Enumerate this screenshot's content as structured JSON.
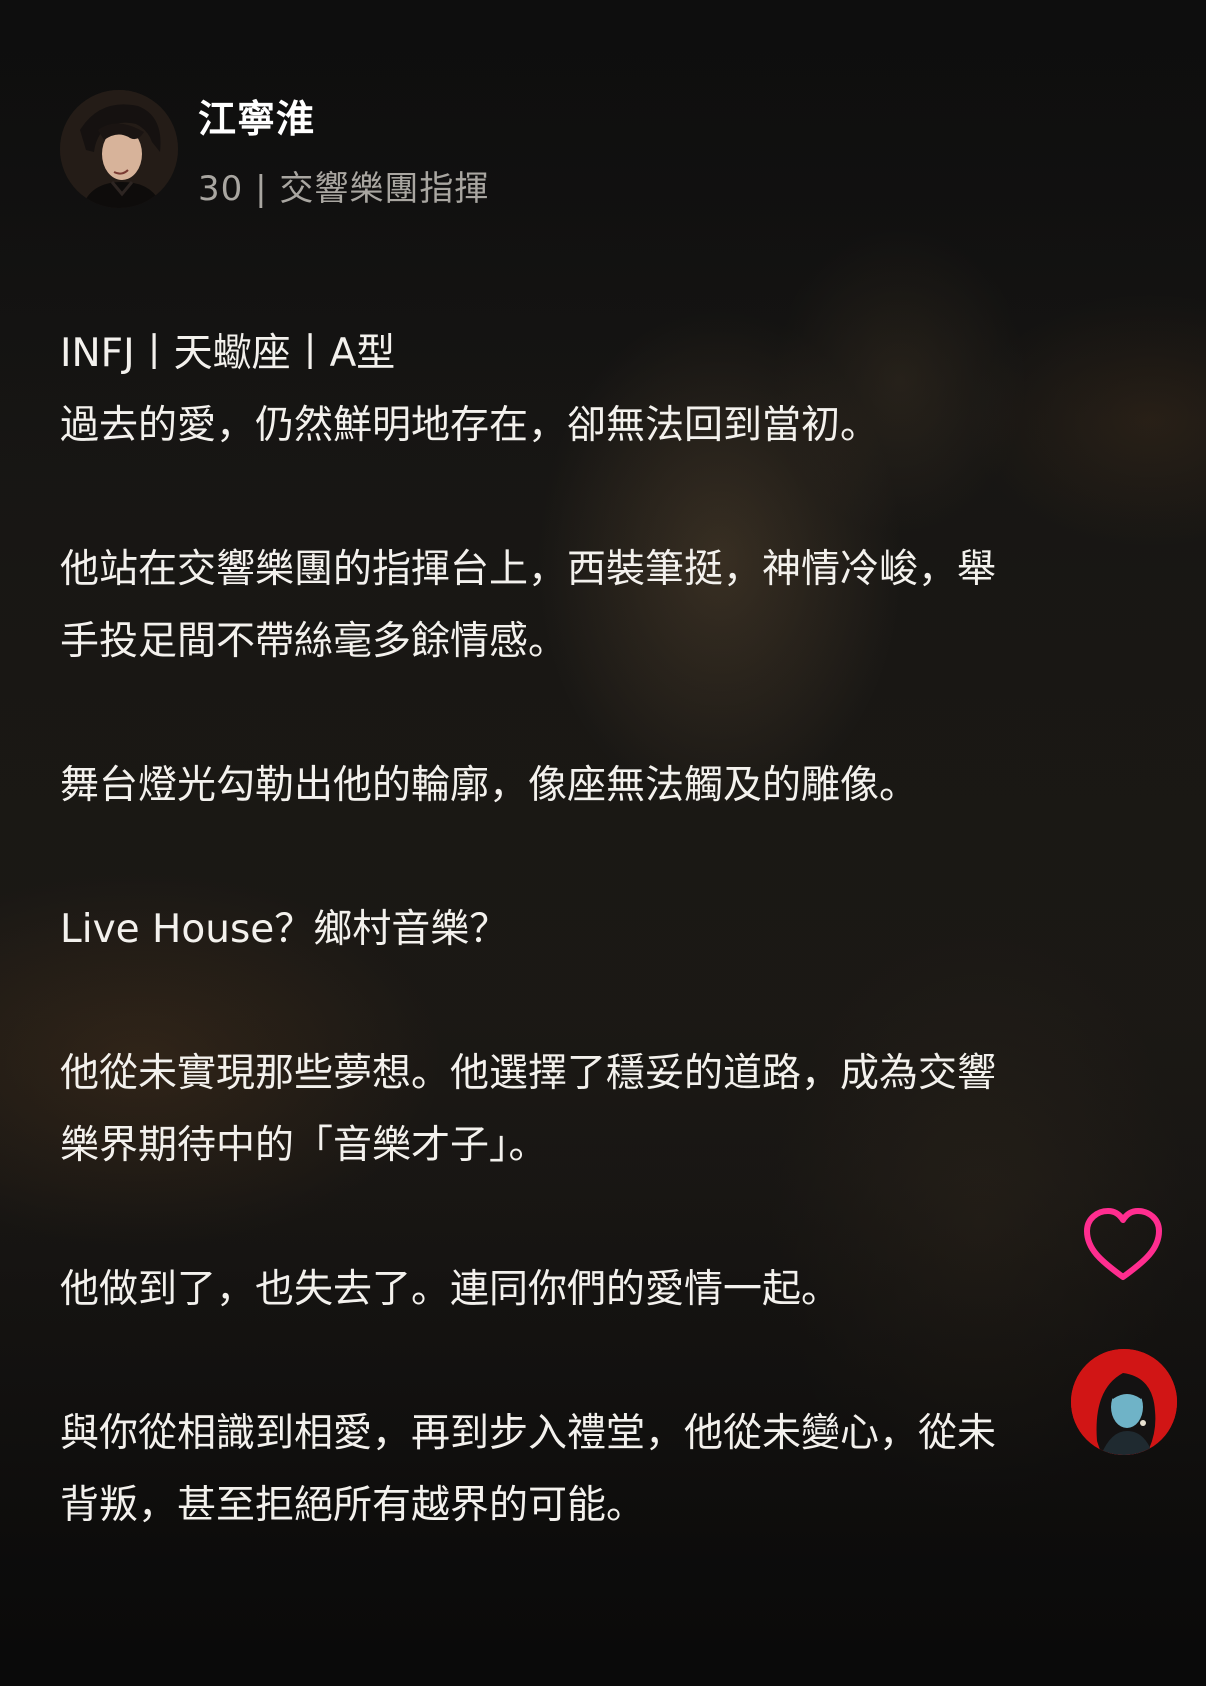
{
  "profile": {
    "name": "江寧淮",
    "subtitle": "30 | 交響樂團指揮",
    "avatar_icon": "man-portrait-avatar"
  },
  "content": {
    "line_tags": "INFJ丨天蠍座丨A型",
    "line_intro": "過去的愛，仍然鮮明地存在，卻無法回到當初。",
    "para_1": "他站在交響樂團的指揮台上，西裝筆挺，神情冷峻，舉手投足間不帶絲毫多餘情感。",
    "para_2": "舞台燈光勾勒出他的輪廓，像座無法觸及的雕像。",
    "para_3": "Live House？鄉村音樂？",
    "para_4": "他從未實現那些夢想。他選擇了穩妥的道路，成為交響樂界期待中的「音樂才子」。",
    "para_5": "他做到了，也失去了。連同你們的愛情一起。",
    "para_6": "與你從相識到相愛，再到步入禮堂，他從未變心，從未背叛，甚至拒絕所有越界的可能。"
  },
  "actions": {
    "like_icon": "heart-icon",
    "like_color": "#ff2d8f",
    "user_avatar_icon": "woman-portrait-avatar",
    "user_avatar_color": "#d11515"
  }
}
